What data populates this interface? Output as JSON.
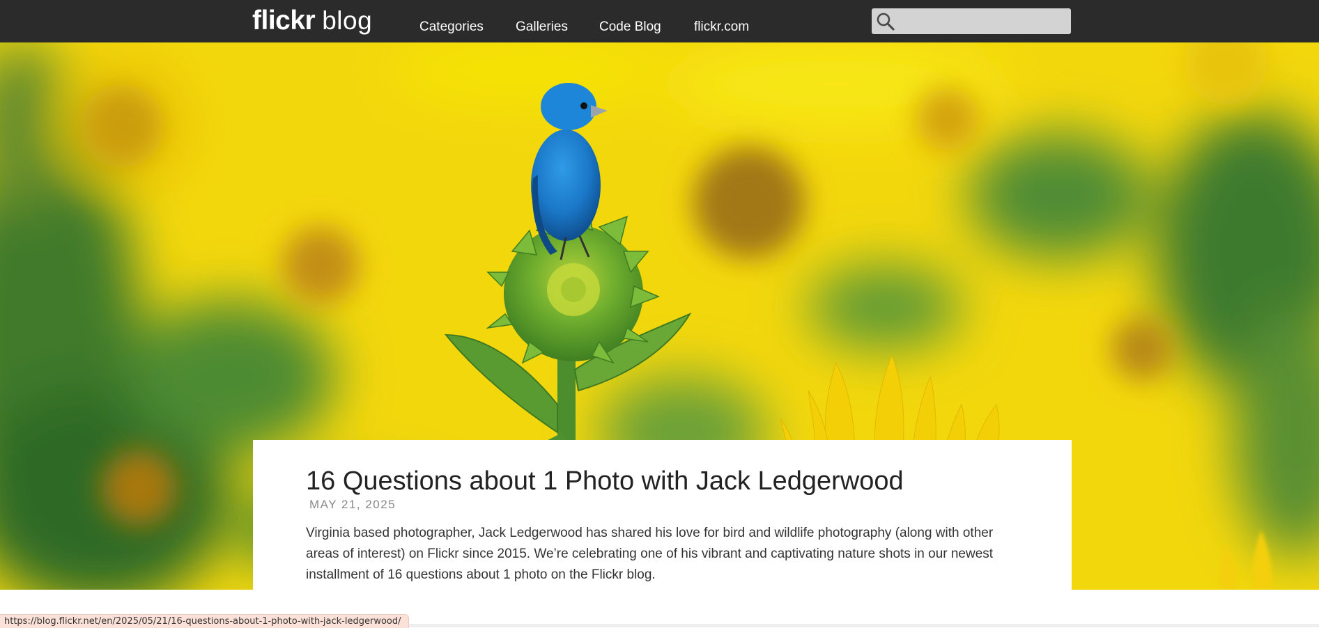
{
  "header": {
    "logo_bold": "flickr",
    "logo_light": "blog",
    "nav": [
      "Categories",
      "Galleries",
      "Code Blog",
      "flickr.com"
    ],
    "search": {
      "placeholder": "",
      "value": ""
    }
  },
  "post": {
    "title": "16 Questions about 1 Photo with Jack Ledgerwood",
    "date": "MAY 21, 2025",
    "excerpt": "Virginia based photographer, Jack Ledgerwood has shared his love for bird and wildlife photography (along with other areas of interest) on Flickr since 2015. We’re celebrating one of his vibrant and captivating nature shots in our newest installment of 16 questions about 1 photo on the Flickr blog."
  },
  "status_bar": {
    "url": "https://blog.flickr.net/en/2025/05/21/16-questions-about-1-photo-with-jack-ledgerwood/"
  },
  "colors": {
    "header_bg": "#2b2b2b",
    "search_bg": "#d3d3d3",
    "hero_yellow": "#f5d90a",
    "bird_blue": "#1f7fd1",
    "card_bg": "#ffffff"
  },
  "icons": {
    "search": "search-icon"
  }
}
